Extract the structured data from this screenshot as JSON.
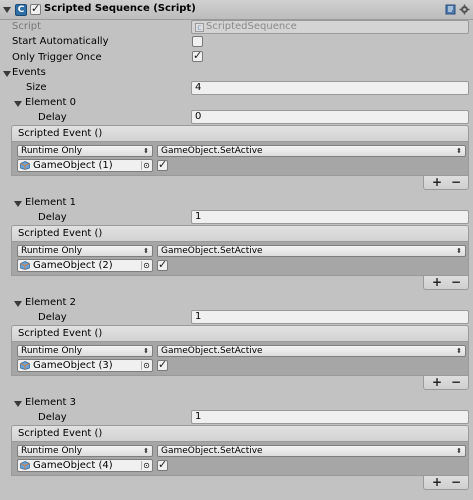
{
  "component": {
    "title": "Scripted Sequence (Script)",
    "script_label": "Script",
    "script_value": "ScriptedSequence",
    "start_auto_label": "Start Automatically",
    "start_auto_checked": false,
    "trigger_once_label": "Only Trigger Once",
    "trigger_once_checked": true,
    "events_label": "Events",
    "size_label": "Size",
    "size_value": "4",
    "icons": [
      "script-icon",
      "book-icon",
      "gear-icon"
    ]
  },
  "elements": [
    {
      "name": "Element 0",
      "delay_label": "Delay",
      "delay": "0",
      "event_label": "Scripted Event ()",
      "runtime": "Runtime Only",
      "function": "GameObject.SetActive",
      "target": "GameObject (1)",
      "arg_checked": true
    },
    {
      "name": "Element 1",
      "delay_label": "Delay",
      "delay": "1",
      "event_label": "Scripted Event ()",
      "runtime": "Runtime Only",
      "function": "GameObject.SetActive",
      "target": "GameObject (2)",
      "arg_checked": true
    },
    {
      "name": "Element 2",
      "delay_label": "Delay",
      "delay": "1",
      "event_label": "Scripted Event ()",
      "runtime": "Runtime Only",
      "function": "GameObject.SetActive",
      "target": "GameObject (3)",
      "arg_checked": true
    },
    {
      "name": "Element 3",
      "delay_label": "Delay",
      "delay": "1",
      "event_label": "Scripted Event ()",
      "runtime": "Runtime Only",
      "function": "GameObject.SetActive",
      "target": "GameObject (4)",
      "arg_checked": true
    }
  ],
  "list_controls": {
    "add": "+",
    "remove": "−"
  },
  "picker_glyph": "⊙"
}
